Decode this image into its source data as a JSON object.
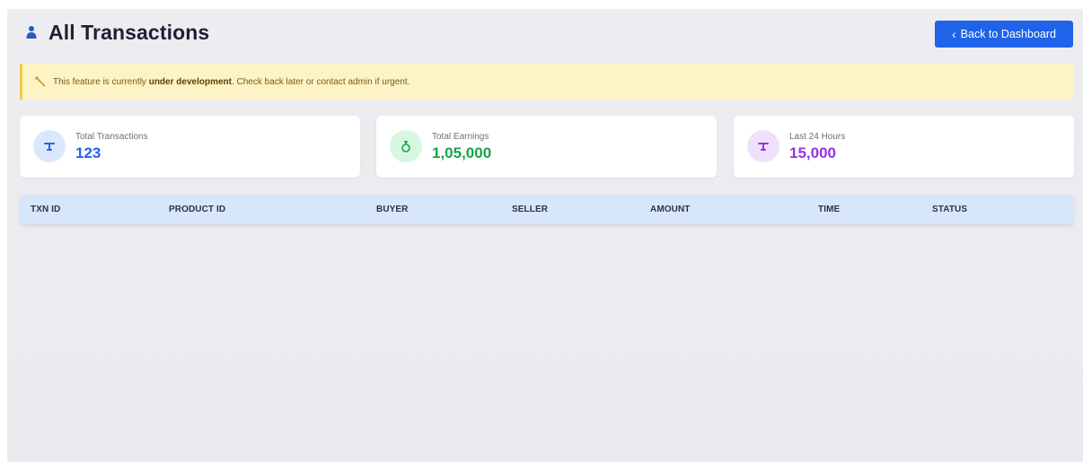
{
  "header": {
    "title": "All Transactions",
    "back_label": "Back to Dashboard",
    "title_icon": "user-icon",
    "back_icon": "chevron-left-icon"
  },
  "alert": {
    "icon": "tools-icon",
    "text_before": "This feature is currently ",
    "text_bold": "under development",
    "text_after": ". Check back later or contact admin if urgent."
  },
  "stats": [
    {
      "label": "Total Transactions",
      "value": "123",
      "icon": "scale-icon",
      "color": "#2563eb",
      "icon_bg": "#dbe7fd"
    },
    {
      "label": "Total Earnings",
      "value": "1,05,000",
      "icon": "money-bag-icon",
      "color": "#16a34a",
      "icon_bg": "#d9f6e3"
    },
    {
      "label": "Last 24 Hours",
      "value": "15,000",
      "icon": "scale-icon",
      "color": "#9333ea",
      "icon_bg": "#efe1fc"
    }
  ],
  "table": {
    "columns": [
      "TXN ID",
      "PRODUCT ID",
      "BUYER",
      "SELLER",
      "AMOUNT",
      "TIME",
      "STATUS"
    ],
    "rows": []
  },
  "colors": {
    "primary": "#1e63e9",
    "alert_bg": "#fdf4c5",
    "alert_border": "#f2c94c",
    "table_header_bg": "#d8e6fb"
  }
}
